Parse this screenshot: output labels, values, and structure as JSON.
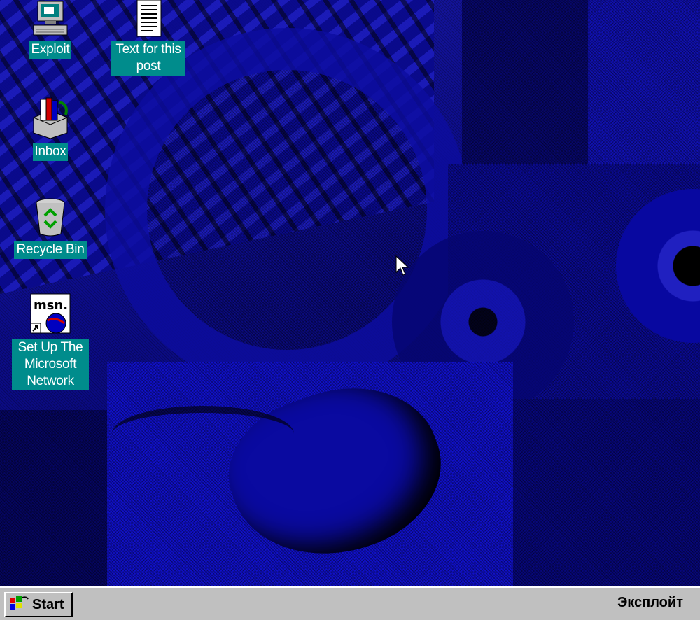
{
  "desktop": {
    "icons": [
      {
        "name": "exploit",
        "label": "Exploit",
        "icon": "computer-icon"
      },
      {
        "name": "text-for-this-post",
        "label": "Text for this post",
        "icon": "notepad-document-icon"
      },
      {
        "name": "inbox",
        "label": "Inbox",
        "icon": "inbox-icon"
      },
      {
        "name": "recycle-bin",
        "label": "Recycle Bin",
        "icon": "recycle-bin-icon"
      },
      {
        "name": "set-up-msn",
        "label": "Set Up The Microsoft Network",
        "icon": "msn-icon"
      }
    ]
  },
  "taskbar": {
    "start_label": "Start",
    "tray_text": "Эксплойт"
  },
  "colors": {
    "desktop_blue": "#0c0c88",
    "icon_label_bg": "#008c8c",
    "taskbar": "#c0c0c0"
  }
}
